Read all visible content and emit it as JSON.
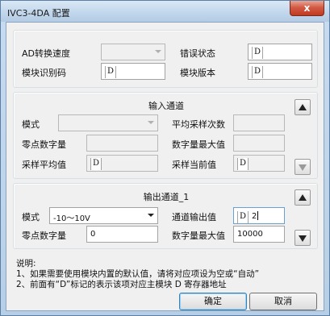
{
  "window": {
    "title": "IVC3-4DA 配置",
    "close_glyph": "x"
  },
  "status_group": {
    "ad_speed_label": "AD转换速度",
    "ad_speed_value": "",
    "error_status_label": "错误状态",
    "error_status_prefix": "D",
    "error_status_value": "",
    "module_id_label": "模块识别码",
    "module_id_prefix": "D",
    "module_id_value": "",
    "module_version_label": "模块版本",
    "module_version_prefix": "D",
    "module_version_value": ""
  },
  "input_group": {
    "title": "输入通道",
    "mode_label": "模式",
    "mode_value": "",
    "avg_count_label": "平均采样次数",
    "avg_count_value": "",
    "zero_digital_label": "零点数字量",
    "zero_digital_value": "",
    "max_digital_label": "数字量最大值",
    "max_digital_value": "",
    "sample_avg_label": "采样平均值",
    "sample_avg_prefix": "D",
    "sample_avg_value": "",
    "sample_current_label": "采样当前值",
    "sample_current_prefix": "D",
    "sample_current_value": ""
  },
  "output_group": {
    "title": "输出通道_1",
    "mode_label": "模式",
    "mode_value": "-10～10V",
    "channel_output_label": "通道输出值",
    "channel_output_prefix": "D",
    "channel_output_value": "2",
    "zero_digital_label": "零点数字量",
    "zero_digital_value": "0",
    "max_digital_label": "数字量最大值",
    "max_digital_value": "10000"
  },
  "notes": {
    "heading": "说明:",
    "line1": "1、如果需要使用模块内置的默认值，请将对应项设为空或“自动”",
    "line2": "2、前面有“D”标记的表示该项对应主模块 D 寄存器地址"
  },
  "buttons": {
    "ok_label": "确定",
    "cancel_label": "取消"
  }
}
